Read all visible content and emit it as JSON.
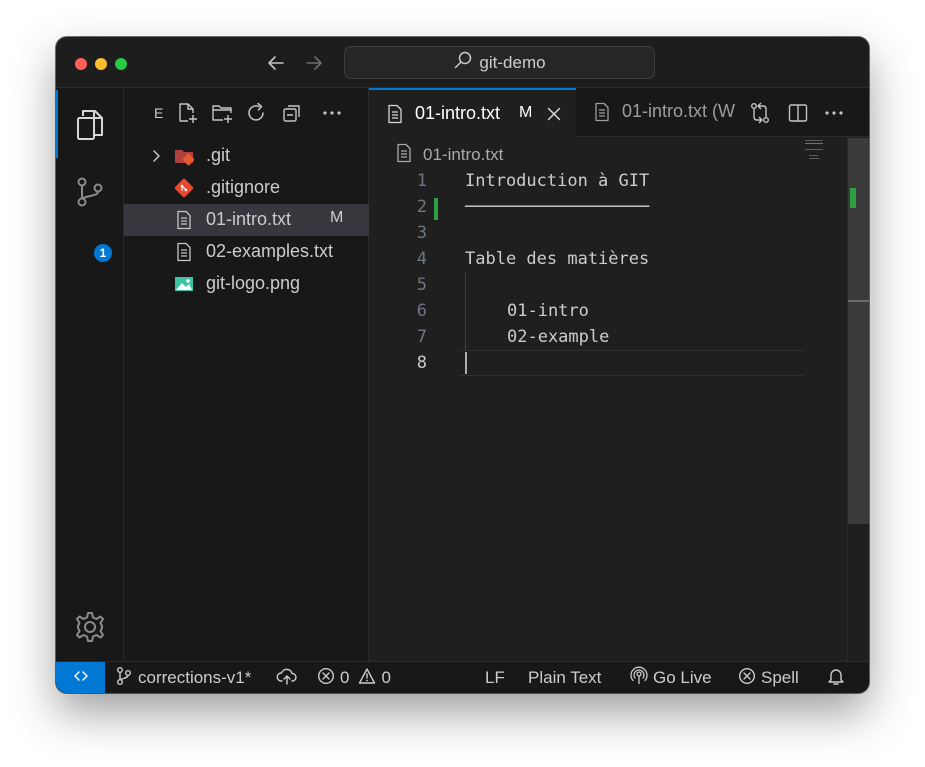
{
  "titlebar": {
    "search_label": "git-demo",
    "icons": [
      "arrow-left-icon",
      "arrow-right-icon",
      "search-icon"
    ]
  },
  "activitybar": {
    "items": [
      "explorer",
      "source-control",
      "settings"
    ],
    "source_control_badge": "1",
    "accent": "#0078d4"
  },
  "explorer": {
    "title": "E",
    "toolbar": [
      "new-file",
      "new-folder",
      "refresh",
      "collapse-all",
      "more"
    ],
    "items": [
      {
        "label": ".git",
        "type": "folder",
        "collapsed": true,
        "status": ""
      },
      {
        "label": ".gitignore",
        "type": "git-file",
        "status": ""
      },
      {
        "label": "01-intro.txt",
        "type": "text-file",
        "status": "M",
        "selected": true
      },
      {
        "label": "02-examples.txt",
        "type": "text-file",
        "status": ""
      },
      {
        "label": "git-logo.png",
        "type": "image-file",
        "status": ""
      }
    ]
  },
  "tabs": [
    {
      "label": "01-intro.txt",
      "status": "M",
      "active": true
    },
    {
      "label": "01-intro.txt (W",
      "active": false
    }
  ],
  "breadcrumb": {
    "file": "01-intro.txt"
  },
  "editor": {
    "lines": [
      {
        "number": "1",
        "text": "Introduction à GIT"
      },
      {
        "number": "2",
        "text": "──────────────────",
        "modified": true
      },
      {
        "number": "3",
        "text": ""
      },
      {
        "number": "4",
        "text": "Table des matières"
      },
      {
        "number": "5",
        "text": ""
      },
      {
        "number": "6",
        "text": "01-intro"
      },
      {
        "number": "7",
        "text": "02-example"
      },
      {
        "number": "8",
        "text": "",
        "current": true
      }
    ]
  },
  "statusbar": {
    "branch": "corrections-v1*",
    "errors": "0",
    "warnings": "0",
    "eol": "LF",
    "language": "Plain Text",
    "go_live": "Go Live",
    "spell": "Spell"
  }
}
